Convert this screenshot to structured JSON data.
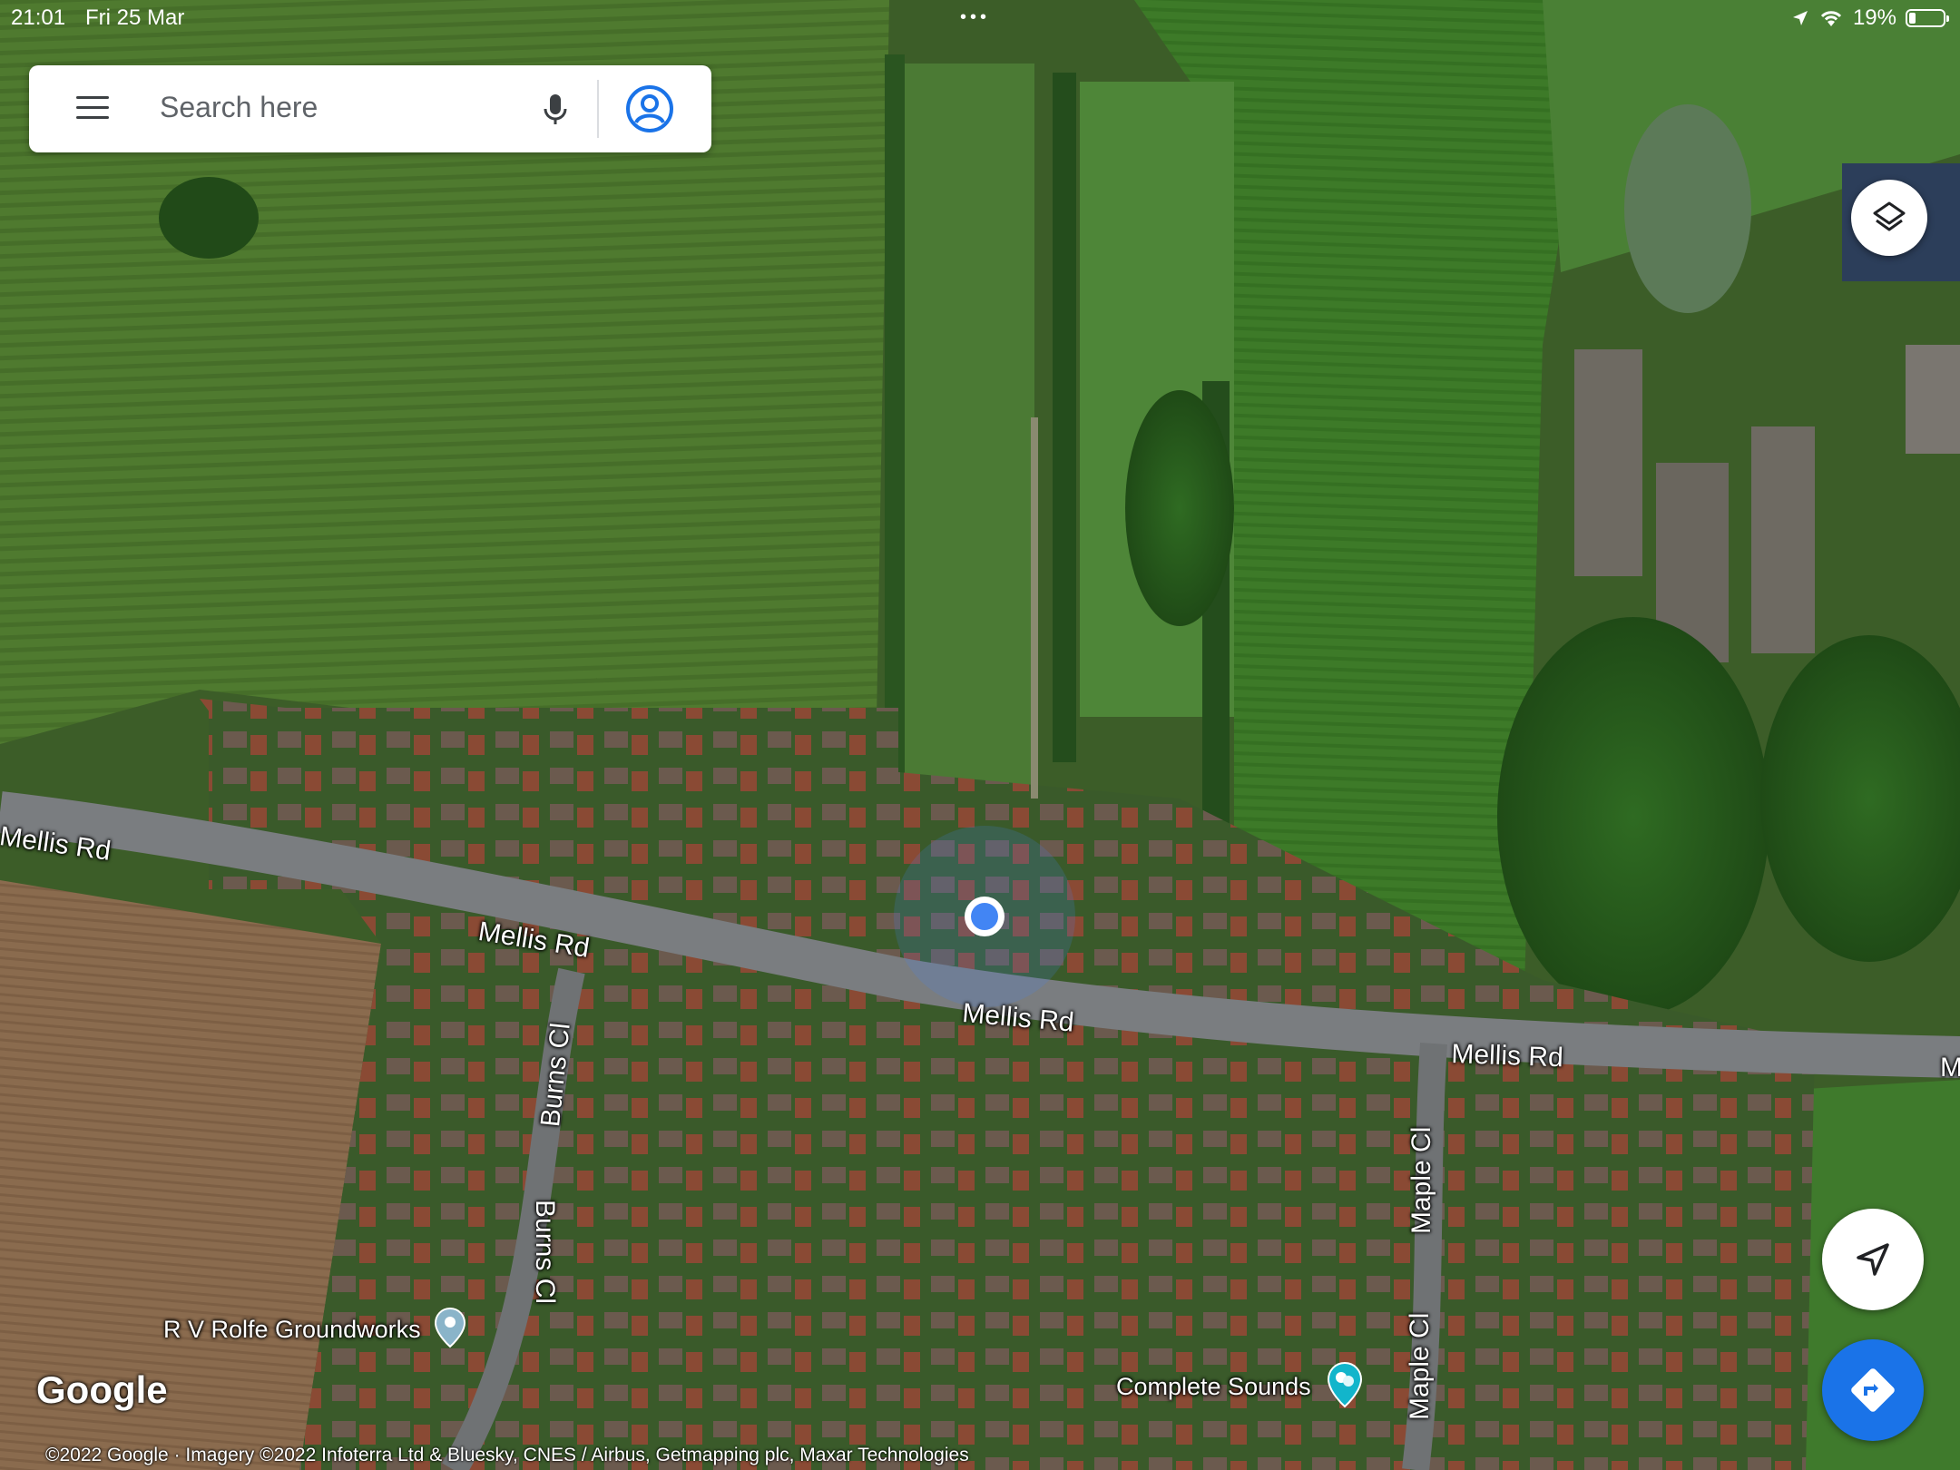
{
  "status_bar": {
    "time": "21:01",
    "date": "Fri 25 Mar",
    "battery": "19%",
    "battery_level": 0.19,
    "icons": [
      "location-arrow-icon",
      "wifi-icon",
      "battery-icon"
    ]
  },
  "search": {
    "placeholder": "Search here",
    "icons": [
      "menu-icon",
      "mic-icon",
      "account-icon"
    ]
  },
  "map": {
    "type": "satellite",
    "roads": [
      {
        "name": "Mellis Rd"
      },
      {
        "name": "Burns Cl"
      },
      {
        "name": "Maple Cl"
      }
    ],
    "road_labels": [
      "Mellis Rd",
      "Mellis Rd",
      "Mellis Rd",
      "Mellis Rd",
      "M",
      "Burns Cl",
      "Burns Cl",
      "Maple Cl",
      "Maple Cl"
    ],
    "places": [
      {
        "name": "R V Rolfe Groundworks",
        "icon": "place-pin-icon",
        "color": "#8ab4c9"
      },
      {
        "name": "Complete Sounds",
        "icon": "theater-pin-icon",
        "color": "#12b5cb"
      }
    ],
    "current_location_color": "#4285f4"
  },
  "controls": {
    "layers_icon": "layers-icon",
    "locate_icon": "navigation-arrow-icon",
    "directions_icon": "directions-icon",
    "directions_color": "#1a73e8"
  },
  "branding": {
    "logo": "Google",
    "attribution": "©2022 Google · Imagery ©2022 Infoterra Ltd & Bluesky, CNES / Airbus, Getmapping plc, Maxar Technologies"
  }
}
